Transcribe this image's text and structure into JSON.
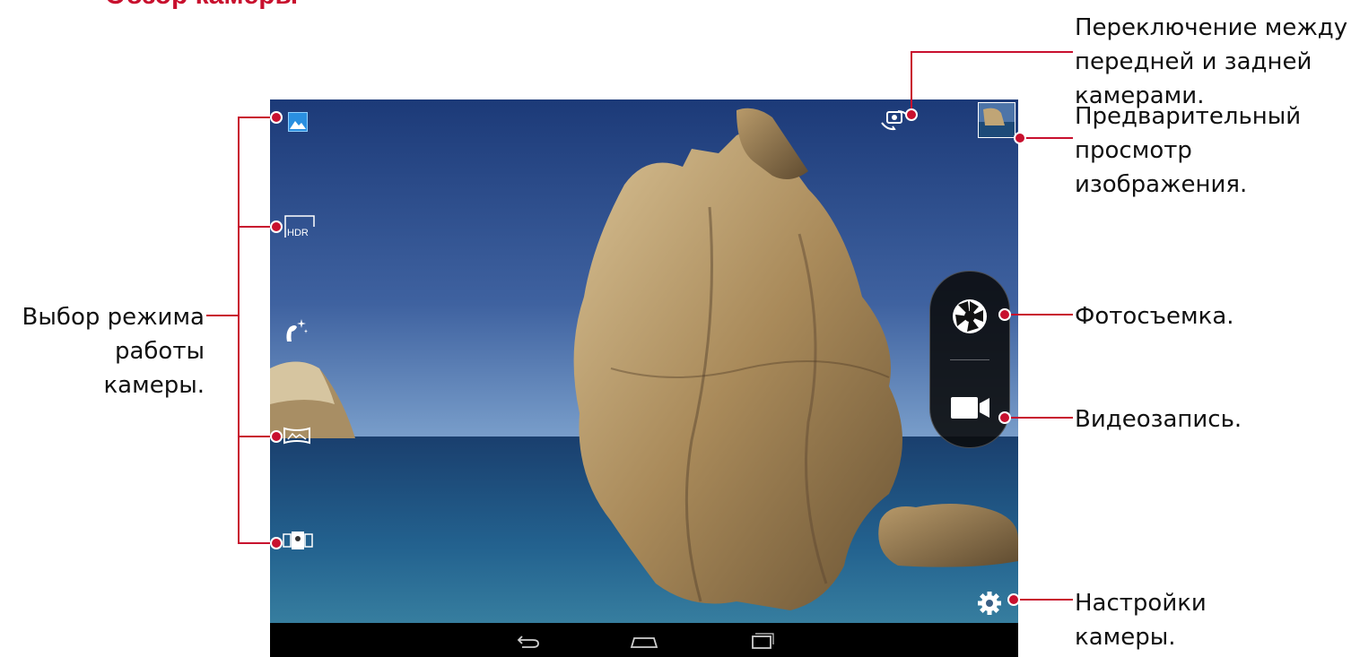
{
  "page": {
    "title": "Обзор камеры"
  },
  "callouts": {
    "mode_select": [
      "Выбор режима",
      "работы камеры."
    ],
    "switch_camera": [
      "Переключение между",
      "передней и задней",
      "камерами."
    ],
    "preview": [
      "Предварительный",
      "просмотр",
      "изображения."
    ],
    "photo": "Фотосъемка.",
    "video": "Видеозапись.",
    "settings": [
      "Настройки",
      "камеры."
    ]
  },
  "camera_ui": {
    "modes": [
      {
        "icon": "landscape-mode-icon",
        "label": "",
        "selected": true
      },
      {
        "icon": "hdr-mode-icon",
        "label": "HDR",
        "selected": false
      },
      {
        "icon": "beauty-mode-icon",
        "label": "",
        "selected": false
      },
      {
        "icon": "panorama-mode-icon",
        "label": "",
        "selected": false
      },
      {
        "icon": "all-focus-mode-icon",
        "label": "",
        "selected": false
      }
    ],
    "top_controls": [
      "switch-camera-icon",
      "gallery-preview-thumbnail"
    ],
    "capture": [
      "shutter-icon",
      "video-camera-icon"
    ],
    "settings_icon": "gear-icon",
    "navbar": [
      "back-icon",
      "home-icon",
      "recent-apps-icon"
    ]
  },
  "colors": {
    "accent": "#c8102e",
    "sky_top": "#1c3a78",
    "sky_bottom": "#6f96c4",
    "sea": "#1c4e7c",
    "rock": "#b79b6c",
    "mode_highlight": "#3aa0e8"
  }
}
